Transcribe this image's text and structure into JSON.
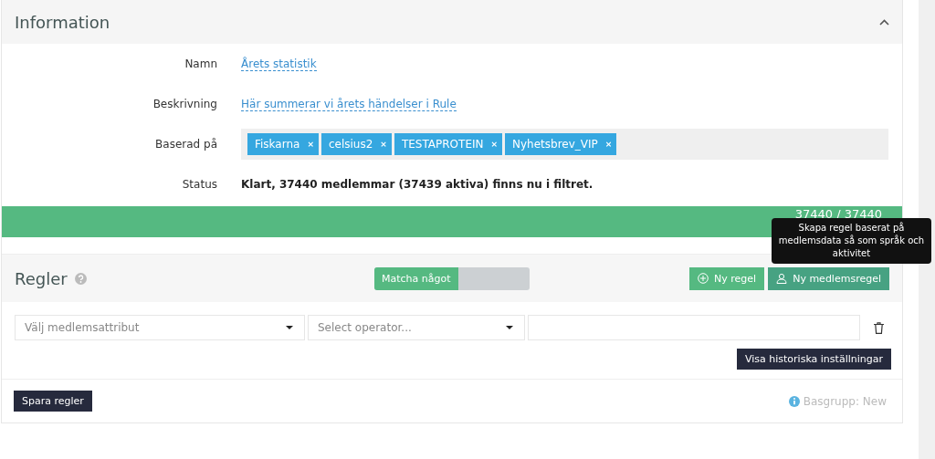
{
  "information": {
    "title": "Information",
    "expanded": true,
    "fields": [
      {
        "kind": "link",
        "label": "Namn",
        "value": "Årets statistik"
      },
      {
        "kind": "link",
        "label": "Beskrivning",
        "value": "Här summerar vi årets händelser i Rule"
      },
      {
        "kind": "tags",
        "label": "Baserad på",
        "tags": [
          {
            "label": "Fiskarna",
            "remove": "×"
          },
          {
            "label": "celsius2",
            "remove": "×"
          },
          {
            "label": "TESTAPROTEIN",
            "remove": "×"
          },
          {
            "label": "Nyhetsbrev_VIP",
            "remove": "×"
          }
        ]
      },
      {
        "kind": "bold",
        "label": "Status",
        "value": "Klart, 37440 medlemmar (37439 aktiva) finns nu i filtret."
      }
    ],
    "progress": {
      "level": 1,
      "reading": "37440 / 37440"
    }
  },
  "rules": {
    "title": "Regler",
    "match_toggle": {
      "label": "Matcha något",
      "on": true
    },
    "buttons": [
      {
        "kind": "plus",
        "label": "Ny regel"
      },
      {
        "kind": "person",
        "label": "Ny medlemsregel"
      }
    ],
    "tooltip": "Skapa regel baserat på medlemsdata så som språk och aktivitet",
    "rule_row": {
      "attribute_placeholder": "Välj medlemsattribut",
      "operator_placeholder": "Select operator..."
    },
    "history_button": "Visa historiska inställningar",
    "save_button": "Spara regler",
    "base_group": "Basgrupp: New"
  }
}
